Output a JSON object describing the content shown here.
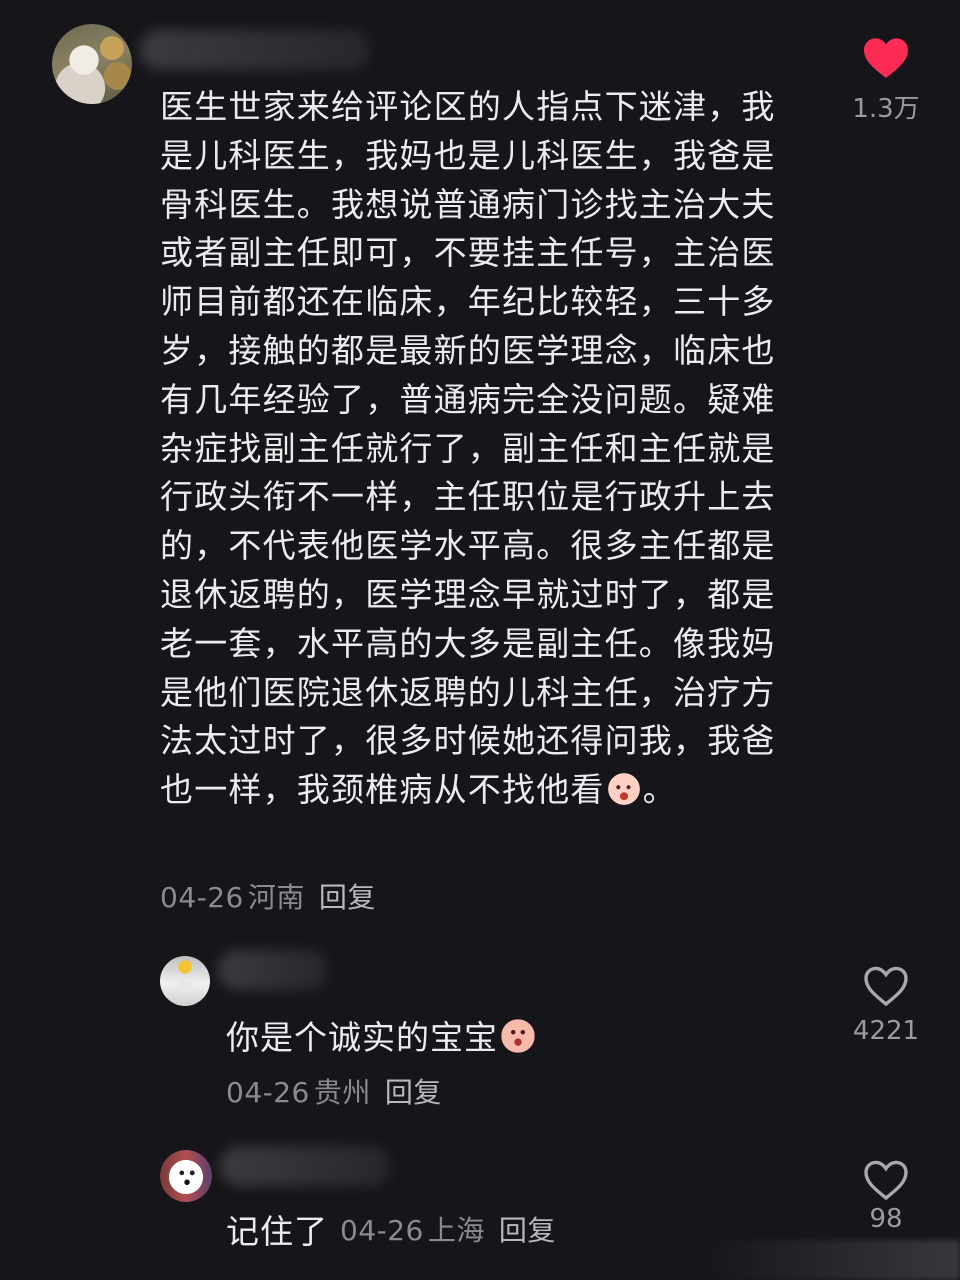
{
  "main_comment": {
    "text_before_emoji": "医生世家来给评论区的人指点下迷津，我是儿科医生，我妈也是儿科医生，我爸是骨科医生。我想说普通病门诊找主治大夫或者副主任即可，不要挂主任号，主治医师目前都还在临床，年纪比较轻，三十多岁，接触的都是最新的医学理念，临床也有几年经验了，普通病完全没问题。疑难杂症找副主任就行了，副主任和主任就是行政头衔不一样，主任职位是行政升上去的，不代表他医学水平高。很多主任都是退休返聘的，医学理念早就过时了，都是老一套，水平高的大多是副主任。像我妈是他们医院退休返聘的儿科主任，治疗方法太过时了，很多时候她还得问我，我爸也一样，我颈椎病从不找他看",
    "text_after_emoji": "。",
    "emoji_icon": "crying-face-icon",
    "date": "04-26",
    "location": "河南",
    "reply_label": "回复",
    "likes": "1.3万",
    "liked": true,
    "like_color": "#fe2c55"
  },
  "replies": [
    {
      "text": "你是个诚实的宝宝",
      "emoji_icon": "surprised-face-icon",
      "date": "04-26",
      "location": "贵州",
      "reply_label": "回复",
      "likes": "4221",
      "liked": false
    },
    {
      "text": "记住了",
      "date": "04-26",
      "location": "上海",
      "reply_label": "回复",
      "likes": "98",
      "liked": false
    }
  ],
  "colors": {
    "background": "#16161a",
    "text": "#ececee",
    "meta": "#8a8a90"
  }
}
